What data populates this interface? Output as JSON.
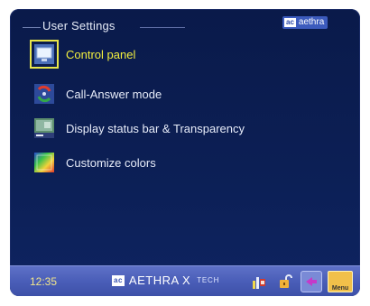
{
  "header": {
    "title": "User Settings",
    "brand_mark": "ac",
    "brand_name": "aethra"
  },
  "menu": {
    "items": [
      {
        "label": "Control panel",
        "icon": "control-panel-icon",
        "selected": true
      },
      {
        "label": "Call-Answer mode",
        "icon": "call-answer-icon",
        "selected": false
      },
      {
        "label": "Display status bar & Transparency",
        "icon": "display-statusbar-icon",
        "selected": false
      },
      {
        "label": "Customize colors",
        "icon": "palette-icon",
        "selected": false
      }
    ]
  },
  "statusbar": {
    "time": "12:35",
    "brand_mark": "ac",
    "brand_name": "AETHRA X",
    "brand_sub": "TECH",
    "menu_label": "Menu"
  },
  "colors": {
    "background": "#0c1f55",
    "selection": "#f2ef3e",
    "statusbar": "#4a5eb8"
  }
}
